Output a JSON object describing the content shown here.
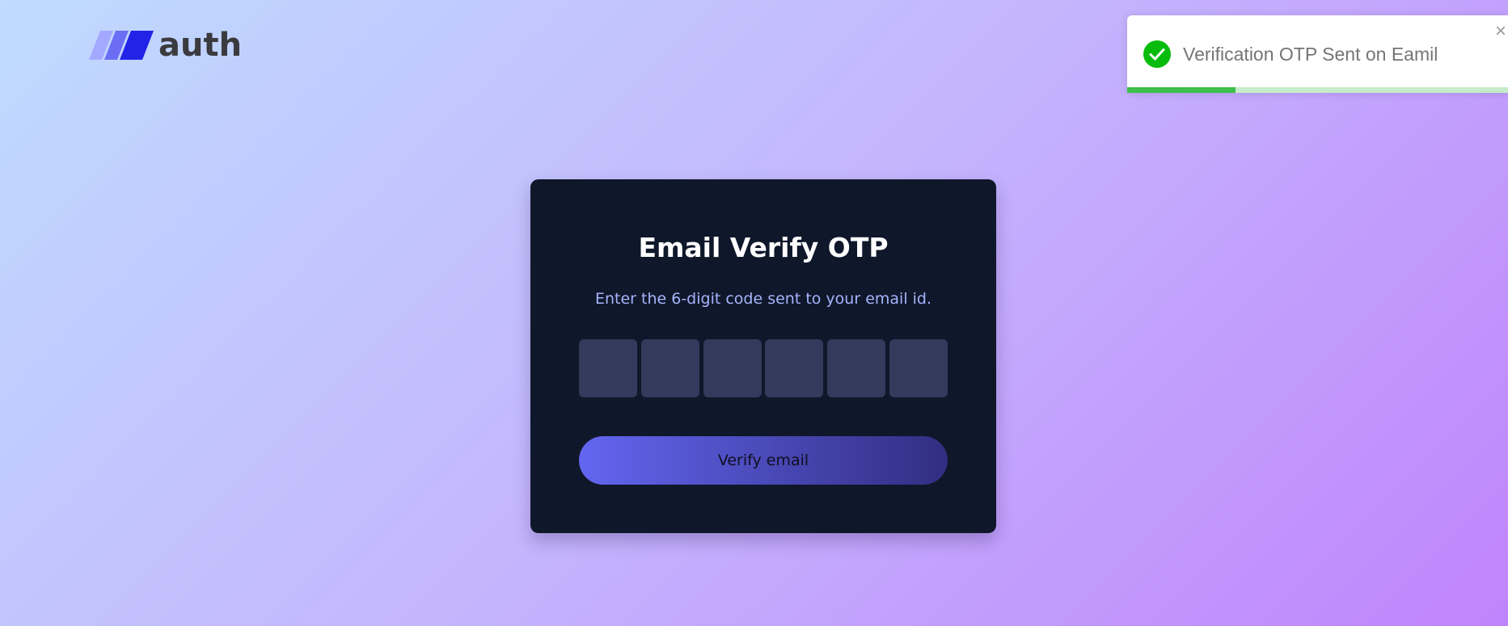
{
  "header": {
    "logo_text": "auth"
  },
  "toast": {
    "message": "Verification OTP Sent on Eamil",
    "close_symbol": "×",
    "progress_fraction": 0.285,
    "icon": "check-circle-icon",
    "colors": {
      "success": "#07bc0c",
      "progress": "#3dbf4a",
      "progress_track": "#c6ecc9"
    }
  },
  "card": {
    "title": "Email Verify OTP",
    "subtitle": "Enter the 6-digit code sent to your email id.",
    "otp_inputs": [
      "",
      "",
      "",
      "",
      "",
      ""
    ],
    "button_label": "Verify email"
  },
  "colors": {
    "card_background": "#0f172a",
    "subtitle": "#a5b4fc",
    "otp_box": "#333a5c",
    "button_gradient_start": "#6366f1",
    "button_gradient_end": "#312e81"
  }
}
